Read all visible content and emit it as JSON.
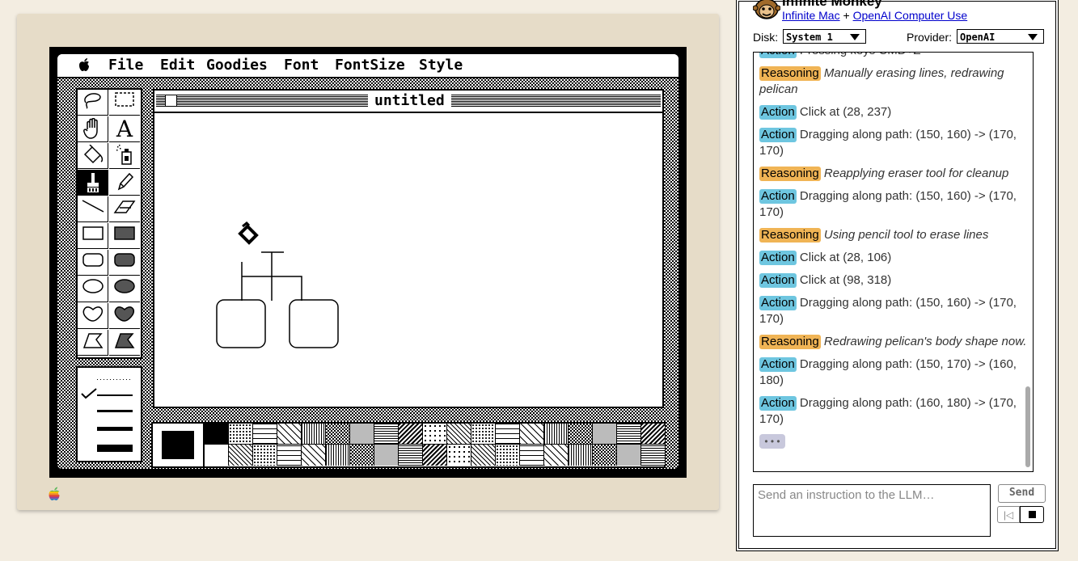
{
  "menubar": {
    "apple_icon": "apple-icon",
    "items": [
      "File",
      "Edit",
      "Goodies",
      "Font",
      "FontSize",
      "Style"
    ]
  },
  "paint_window": {
    "title": "untitled"
  },
  "tools": [
    {
      "name": "lasso-tool",
      "icon": "lasso-icon"
    },
    {
      "name": "select-rect-tool",
      "icon": "marquee-icon"
    },
    {
      "name": "grabber-tool",
      "icon": "hand-icon"
    },
    {
      "name": "text-tool",
      "icon": "text-a-icon",
      "glyph": "A"
    },
    {
      "name": "paint-bucket-tool",
      "icon": "paint-bucket-icon"
    },
    {
      "name": "spray-can-tool",
      "icon": "spray-can-icon"
    },
    {
      "name": "paintbrush-tool",
      "icon": "paintbrush-icon",
      "selected": true
    },
    {
      "name": "pencil-tool",
      "icon": "pencil-icon"
    },
    {
      "name": "line-tool",
      "icon": "line-icon"
    },
    {
      "name": "eraser-tool",
      "icon": "eraser-icon"
    },
    {
      "name": "rect-tool",
      "icon": "rectangle-icon"
    },
    {
      "name": "filled-rect-tool",
      "icon": "filled-rectangle-icon"
    },
    {
      "name": "rounded-rect-tool",
      "icon": "rounded-rectangle-icon"
    },
    {
      "name": "filled-rounded-rect-tool",
      "icon": "filled-rounded-rectangle-icon"
    },
    {
      "name": "oval-tool",
      "icon": "oval-icon"
    },
    {
      "name": "filled-oval-tool",
      "icon": "filled-oval-icon"
    },
    {
      "name": "freeform-tool",
      "icon": "freeform-shape-icon"
    },
    {
      "name": "filled-freeform-tool",
      "icon": "filled-freeform-shape-icon"
    },
    {
      "name": "polygon-tool",
      "icon": "polygon-icon"
    },
    {
      "name": "filled-polygon-tool",
      "icon": "filled-polygon-icon"
    }
  ],
  "line_widths": {
    "selected_index": 1,
    "count": 5
  },
  "patterns": {
    "rows": 2,
    "columns": 19
  },
  "panel": {
    "app_title": "Infinite Monkey",
    "credit_link1": "Infinite Mac",
    "credit_sep": " + ",
    "credit_link2": "OpenAI Computer Use",
    "disk_label": "Disk:",
    "disk_value": "System 1",
    "provider_label": "Provider:",
    "provider_value": "OpenAI",
    "input_placeholder": "Send an instruction to the LLM…",
    "send_label": "Send",
    "rewind_label": "|◁",
    "stop_icon": "stop-icon"
  },
  "log": [
    {
      "type": "action",
      "tag": "Action",
      "text": "Pressing keys CMD+Z"
    },
    {
      "type": "reasoning",
      "tag": "Reasoning",
      "text": "Manually erasing lines, redrawing pelican"
    },
    {
      "type": "action",
      "tag": "Action",
      "text": "Click at (28, 237)"
    },
    {
      "type": "action",
      "tag": "Action",
      "text": "Dragging along path: (150, 160) -> (170, 170)"
    },
    {
      "type": "reasoning",
      "tag": "Reasoning",
      "text": "Reapplying eraser tool for cleanup"
    },
    {
      "type": "action",
      "tag": "Action",
      "text": "Dragging along path: (150, 160) -> (170, 170)"
    },
    {
      "type": "reasoning",
      "tag": "Reasoning",
      "text": "Using pencil tool to erase lines"
    },
    {
      "type": "action",
      "tag": "Action",
      "text": "Click at (28, 106)"
    },
    {
      "type": "action",
      "tag": "Action",
      "text": "Click at (98, 318)"
    },
    {
      "type": "action",
      "tag": "Action",
      "text": "Dragging along path: (150, 160) -> (170, 170)"
    },
    {
      "type": "reasoning",
      "tag": "Reasoning",
      "text": "Redrawing pelican's body shape now."
    },
    {
      "type": "action",
      "tag": "Action",
      "text": "Dragging along path: (150, 170) -> (160, 180)"
    },
    {
      "type": "action",
      "tag": "Action",
      "text": "Dragging along path: (160, 180) -> (170, 170)"
    }
  ],
  "log_ellipsis": "• • •"
}
